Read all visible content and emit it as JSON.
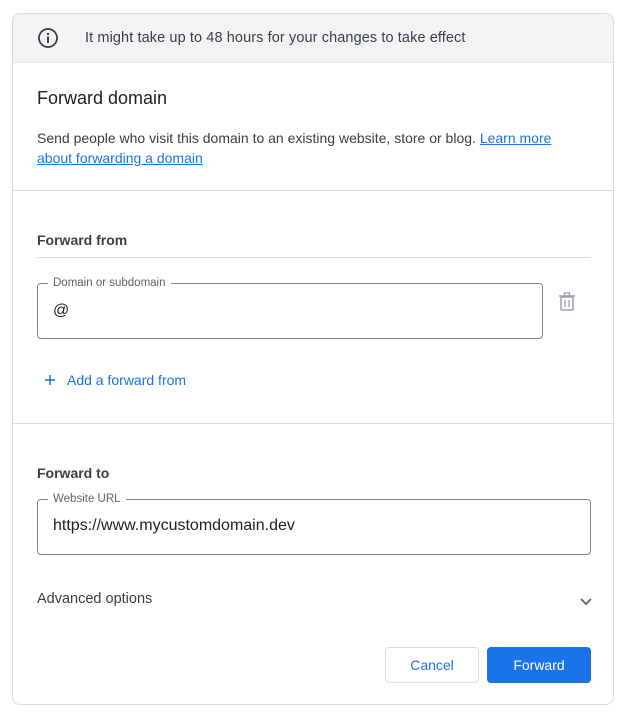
{
  "banner": {
    "icon": "info-icon",
    "text": "It might take up to 48 hours for your changes to take effect"
  },
  "header": {
    "title": "Forward domain",
    "description": "Send people who visit this domain to an existing website, store or blog.",
    "learn_more_link": "Learn more about forwarding a domain"
  },
  "forward_from": {
    "section_label": "Forward from",
    "field_label": "Domain or subdomain",
    "field_value": "@",
    "delete_icon": "trash-icon",
    "add_label": "Add a forward from",
    "add_icon": "plus-icon"
  },
  "forward_to": {
    "section_label": "Forward to",
    "field_label": "Website URL",
    "field_value": "https://www.mycustomdomain.dev"
  },
  "advanced": {
    "label": "Advanced options",
    "icon": "chevron-down-icon"
  },
  "actions": {
    "cancel_label": "Cancel",
    "forward_label": "Forward"
  },
  "colors": {
    "accent": "#1a73e8",
    "banner_bg": "#f1f3f4",
    "border": "#dadce0"
  }
}
